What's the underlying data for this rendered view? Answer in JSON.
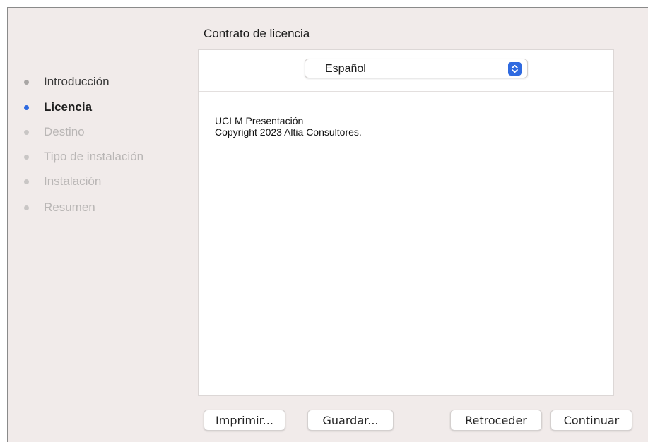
{
  "sidebar": {
    "steps": [
      {
        "label": "Introducción"
      },
      {
        "label": "Licencia"
      },
      {
        "label": "Destino"
      },
      {
        "label": "Tipo de instalación"
      },
      {
        "label": "Instalación"
      },
      {
        "label": "Resumen"
      }
    ],
    "current_step": "Licencia"
  },
  "main": {
    "title": "Contrato de licencia",
    "language_select": {
      "value": "Español"
    },
    "license": {
      "line1": "UCLM Presentación",
      "line2": "Copyright 2023 Altia Consultores."
    }
  },
  "buttons": {
    "print": "Imprimir...",
    "save": "Guardar...",
    "back": "Retroceder",
    "continue": "Continuar"
  },
  "colors": {
    "accent": "#2f6ae0",
    "window_bg": "#f1ebea",
    "panel_bg": "#ffffff"
  },
  "icons": {
    "language_stepper": "chevron-up-down-icon",
    "step_bullet": "dot-icon"
  }
}
